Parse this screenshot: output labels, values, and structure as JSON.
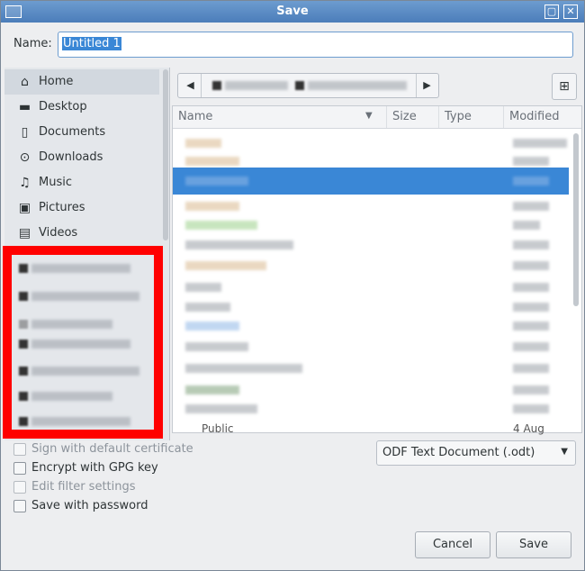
{
  "window": {
    "title": "Save"
  },
  "name": {
    "label": "Name:",
    "value": "Untitled 1"
  },
  "places": [
    {
      "label": "Home",
      "icon": "home-icon"
    },
    {
      "label": "Desktop",
      "icon": "folder-icon"
    },
    {
      "label": "Documents",
      "icon": "document-icon"
    },
    {
      "label": "Downloads",
      "icon": "download-icon"
    },
    {
      "label": "Music",
      "icon": "music-icon"
    },
    {
      "label": "Pictures",
      "icon": "pictures-icon"
    },
    {
      "label": "Videos",
      "icon": "video-icon"
    }
  ],
  "columns": {
    "name": "Name",
    "size": "Size",
    "type": "Type",
    "modified": "Modified"
  },
  "file_list_partial": {
    "name": "Public",
    "modified": "4 Aug"
  },
  "file_type": {
    "selected": "ODF Text Document (.odt)"
  },
  "options": {
    "sign": "Sign with default certificate",
    "encrypt": "Encrypt with GPG key",
    "filter": "Edit filter settings",
    "password": "Save with password"
  },
  "buttons": {
    "cancel": "Cancel",
    "save": "Save"
  },
  "colors": {
    "accent": "#3a87d6",
    "highlight_box": "#ff0000",
    "titlebar": "#4b7dba"
  }
}
